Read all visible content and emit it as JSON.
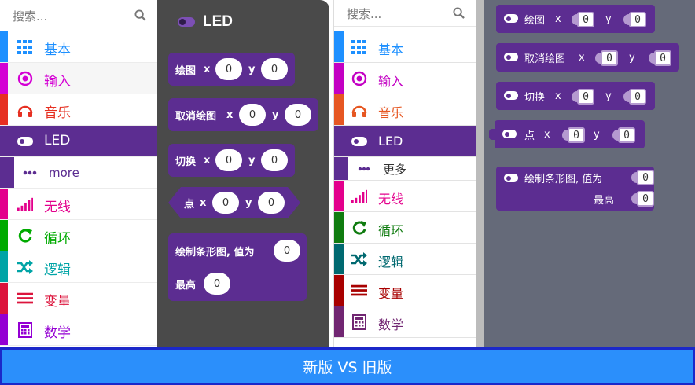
{
  "new_toolbox": {
    "search_placeholder": "搜索...",
    "categories": [
      {
        "label": "基本",
        "color": "#1e90ff",
        "icon": "grid-icon"
      },
      {
        "label": "输入",
        "color": "#d400d4",
        "icon": "radio-target-icon"
      },
      {
        "label": "音乐",
        "color": "#e63022",
        "icon": "headphones-icon"
      },
      {
        "label": "LED",
        "color": "#5c2d91",
        "icon": "toggle-icon",
        "active": true
      },
      {
        "label": "more",
        "color": "#5c2d91",
        "icon": "ellipsis-icon"
      },
      {
        "label": "无线",
        "color": "#e3008c",
        "icon": "signal-bars-icon"
      },
      {
        "label": "循环",
        "color": "#00aa00",
        "icon": "loop-arrow-icon"
      },
      {
        "label": "逻辑",
        "color": "#00a4a6",
        "icon": "shuffle-icon"
      },
      {
        "label": "变量",
        "color": "#dc143c",
        "icon": "lines-icon"
      },
      {
        "label": "数学",
        "color": "#9400d3",
        "icon": "calculator-icon"
      }
    ]
  },
  "flyout": {
    "title": "LED",
    "blocks": [
      {
        "label": "绘图",
        "x_label": "x",
        "x_value": "0",
        "y_label": "y",
        "y_value": "0"
      },
      {
        "label": "取消绘图",
        "x_label": "x",
        "x_value": "0",
        "y_label": "y",
        "y_value": "0"
      },
      {
        "label": "切换",
        "x_label": "x",
        "x_value": "0",
        "y_label": "y",
        "y_value": "0"
      },
      {
        "label": "点",
        "x_label": "x",
        "x_value": "0",
        "y_label": "y",
        "y_value": "0"
      }
    ],
    "bargraph": {
      "label": "绘制条形图, 值为",
      "value": "0",
      "high_label": "最高",
      "high_value": "0"
    }
  },
  "old_toolbox": {
    "search_placeholder": "搜索...",
    "categories": [
      {
        "label": "基本",
        "color": "#1e90ff",
        "icon": "grid-icon"
      },
      {
        "label": "输入",
        "color": "#c300c3",
        "icon": "radio-target-icon"
      },
      {
        "label": "音乐",
        "color": "#e65722",
        "icon": "headphones-icon"
      },
      {
        "label": "LED",
        "color": "#5c2d91",
        "icon": "toggle-icon",
        "active": true
      },
      {
        "label": "更多",
        "color": "#5c2d91",
        "icon": "ellipsis-icon"
      },
      {
        "label": "无线",
        "color": "#e3008c",
        "icon": "signal-bars-icon"
      },
      {
        "label": "循环",
        "color": "#107c10",
        "icon": "loop-arrow-icon"
      },
      {
        "label": "逻辑",
        "color": "#006970",
        "icon": "shuffle-icon"
      },
      {
        "label": "变量",
        "color": "#a80000",
        "icon": "lines-icon"
      },
      {
        "label": "数学",
        "color": "#712672",
        "icon": "calculator-icon"
      }
    ]
  },
  "old_workspace": {
    "blocks": [
      {
        "label": "绘图",
        "x_label": "x",
        "x_value": "0",
        "y_label": "y",
        "y_value": "0"
      },
      {
        "label": "取消绘图",
        "x_label": "x",
        "x_value": "0",
        "y_label": "y",
        "y_value": "0"
      },
      {
        "label": "切换",
        "x_label": "x",
        "x_value": "0",
        "y_label": "y",
        "y_value": "0"
      },
      {
        "label": "点",
        "x_label": "x",
        "x_value": "0",
        "y_label": "y",
        "y_value": "0"
      }
    ],
    "bargraph": {
      "label": "绘制条形图, 值为",
      "value": "0",
      "high_label": "最高",
      "high_value": "0"
    }
  },
  "footer": {
    "caption": "新版 VS 旧版"
  },
  "colors": {
    "led_purple": "#5c2d91",
    "flyout_bg": "#4a4a4a",
    "workspace_bg": "#656a79",
    "footer_bg": "#2b8ffb",
    "footer_border": "#1b28c9"
  }
}
